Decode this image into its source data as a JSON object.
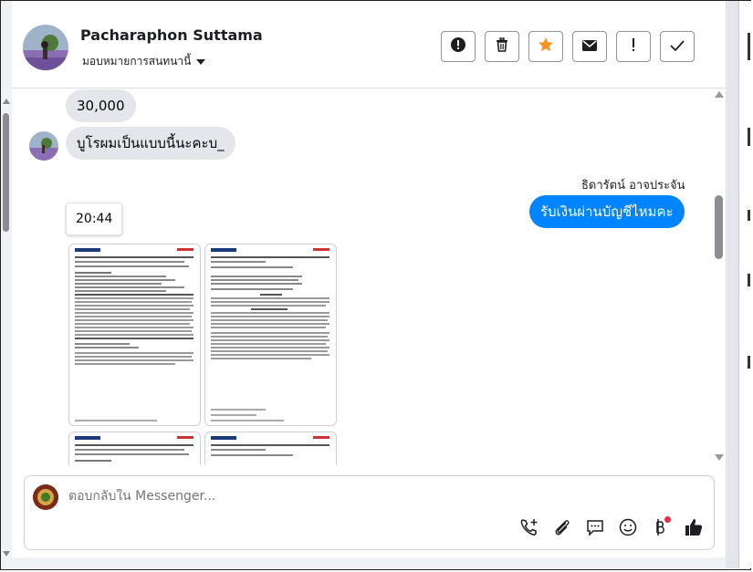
{
  "header": {
    "contact_name": "Pacharaphon Suttama",
    "assign_label": "มอบหมายการสนทนานี้",
    "actions": [
      {
        "icon": "exclamation-circle-icon"
      },
      {
        "icon": "trash-icon"
      },
      {
        "icon": "star-icon"
      },
      {
        "icon": "envelope-icon"
      },
      {
        "icon": "exclamation-icon"
      },
      {
        "icon": "checkmark-icon"
      }
    ],
    "star_color": "#f7931e"
  },
  "messages": {
    "m1": "30,000",
    "m2": "บูโรผมเป็นแบบนี้นะคะบ_",
    "sender": "ธิดารัตน์ อาจประจัน",
    "m3": "รับเงินผ่านบัญชีไหมคะ",
    "time": "20:44"
  },
  "composer": {
    "placeholder": "ตอบกลับใน Messenger...",
    "icons": [
      "call-add-icon",
      "paperclip-icon",
      "chat-bubble-icon",
      "emoji-icon",
      "baht-icon",
      "thumbs-up-icon"
    ]
  },
  "colors": {
    "outgoing_bubble": "#0084ff",
    "incoming_bubble": "#e4e6eb",
    "notification_dot": "#f02849"
  }
}
